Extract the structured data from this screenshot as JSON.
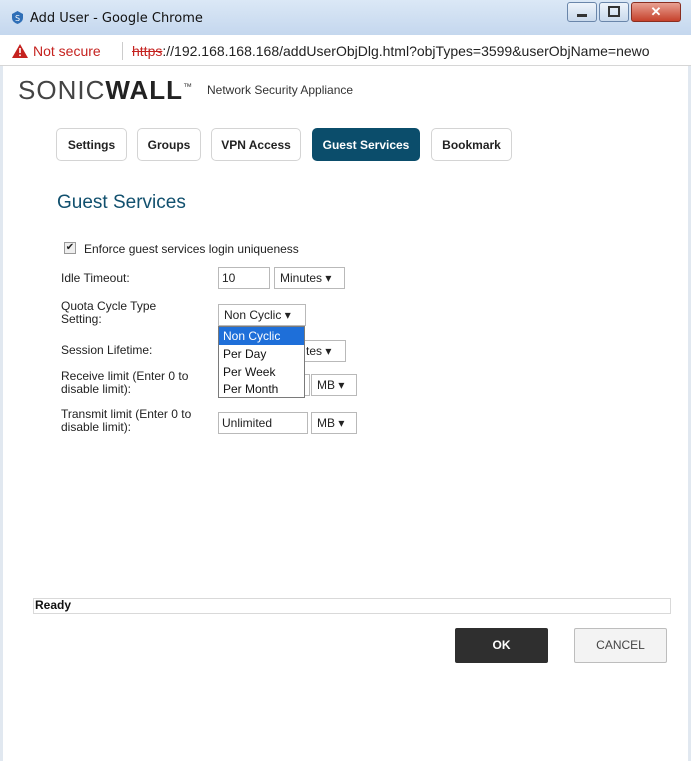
{
  "window": {
    "title": "Add User - Google Chrome"
  },
  "address": {
    "security_label": "Not secure",
    "url_scheme": "https",
    "url_rest": "://192.168.168.168/addUserObjDlg.html?objTypes=3599&userObjName=newo"
  },
  "header": {
    "brand_light": "SONIC",
    "brand_bold": "WALL",
    "brand_tm": "™",
    "subtitle": "Network Security Appliance"
  },
  "tabs": [
    {
      "label": "Settings"
    },
    {
      "label": "Groups"
    },
    {
      "label": "VPN Access"
    },
    {
      "label": "Guest Services",
      "active": true
    },
    {
      "label": "Bookmark"
    }
  ],
  "section": {
    "title": "Guest Services"
  },
  "form": {
    "enforce_label": "Enforce guest services login uniqueness",
    "enforce_checked": true,
    "idle_label": "Idle Timeout:",
    "idle_value": "10",
    "idle_unit": "Minutes",
    "quota_label": "Quota Cycle Type Setting:",
    "quota_value": "Non Cyclic",
    "quota_options": [
      "Non Cyclic",
      "Per Day",
      "Per Week",
      "Per Month"
    ],
    "session_label": "Session Lifetime:",
    "session_unit_partial": "tes",
    "receive_label": "Receive limit (Enter 0 to disable limit):",
    "receive_unit": "MB",
    "transmit_label": "Transmit limit (Enter 0 to disable limit):",
    "transmit_value": "Unlimited",
    "transmit_unit": "MB"
  },
  "status": {
    "text": "Ready"
  },
  "buttons": {
    "ok": "OK",
    "cancel": "CANCEL"
  },
  "colors": {
    "accent": "#0b4d6b",
    "title_blue": "#11506e",
    "highlight": "#1e6fd9"
  }
}
